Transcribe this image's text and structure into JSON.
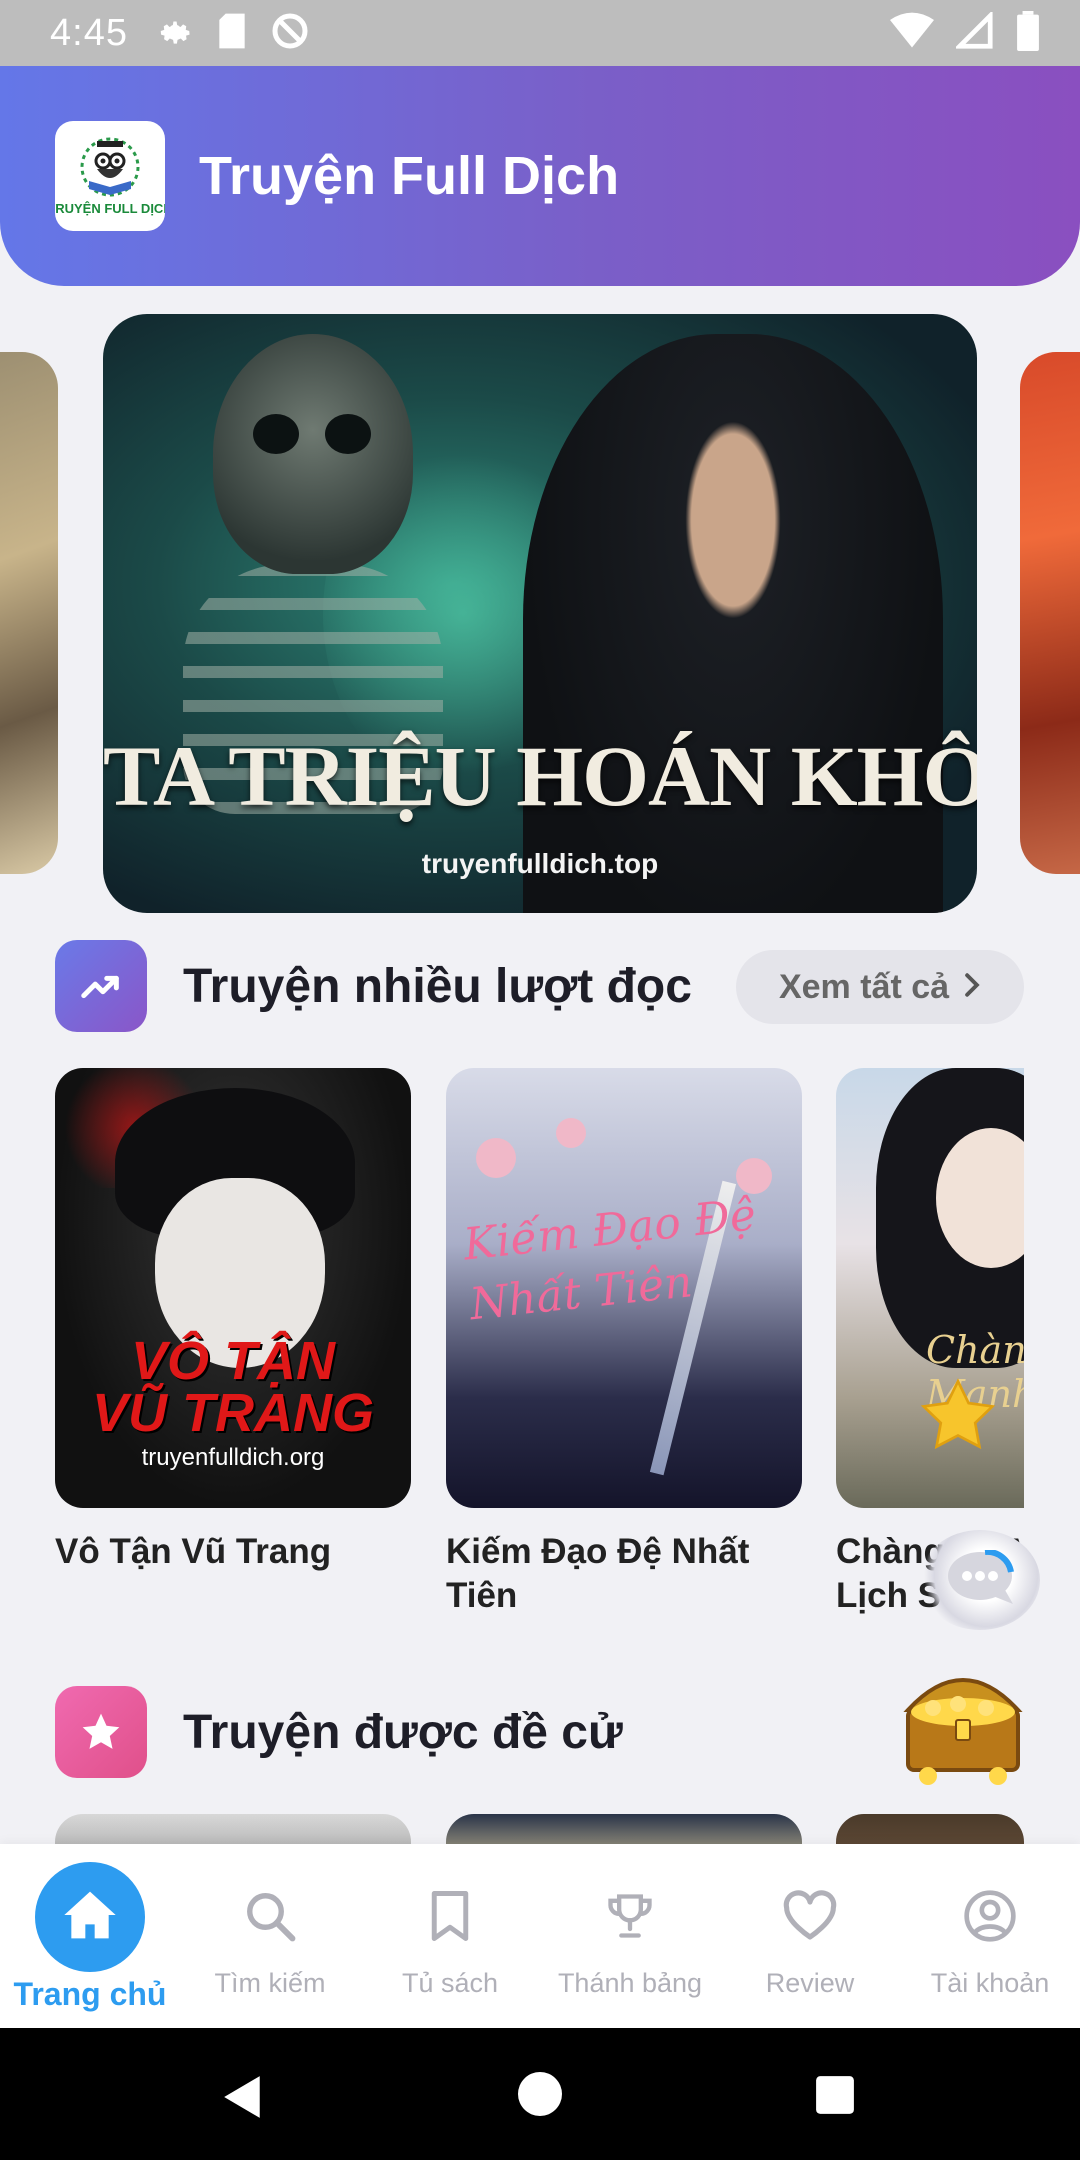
{
  "status_bar": {
    "time": "4:45"
  },
  "header": {
    "app_title": "Truyện Full Dịch",
    "logo_text": "TRUYỆN FULL DỊCH"
  },
  "banner": {
    "title": "TA TRIỆU HOÁN KHÔ LÂU",
    "site": "truyenfulldich.top"
  },
  "section_popular": {
    "title": "Truyện nhiều lượt đọc",
    "see_all": "Xem tất cả",
    "books": [
      {
        "title": "Vô Tận Vũ Trang",
        "cover_line1": "VÔ TẬN",
        "cover_line2": "VŨ TRANG",
        "cover_site": "truyenfulldich.org"
      },
      {
        "title": "Kiếm Đạo Đệ Nhất Tiên",
        "cover_text": "Kiếm Đạo Đệ Nhất Tiên"
      },
      {
        "title": "Chàng Rể Mạnh Nhất Lịch Sử",
        "cover_text": "Chàng Rể Mạnh Nhất"
      }
    ]
  },
  "section_recommended": {
    "title": "Truyện được đề cử"
  },
  "bottom_nav": {
    "items": [
      {
        "label": "Trang chủ",
        "icon": "home-icon"
      },
      {
        "label": "Tìm kiếm",
        "icon": "search-icon"
      },
      {
        "label": "Tủ sách",
        "icon": "bookmark-icon"
      },
      {
        "label": "Thánh bảng",
        "icon": "trophy-icon"
      },
      {
        "label": "Review",
        "icon": "heart-icon"
      },
      {
        "label": "Tài khoản",
        "icon": "account-icon"
      }
    ],
    "active_color": "#2d9cf0"
  },
  "colors": {
    "header_start": "#6477e8",
    "header_end": "#8a4fc0",
    "accent": "#2d9cf0"
  }
}
